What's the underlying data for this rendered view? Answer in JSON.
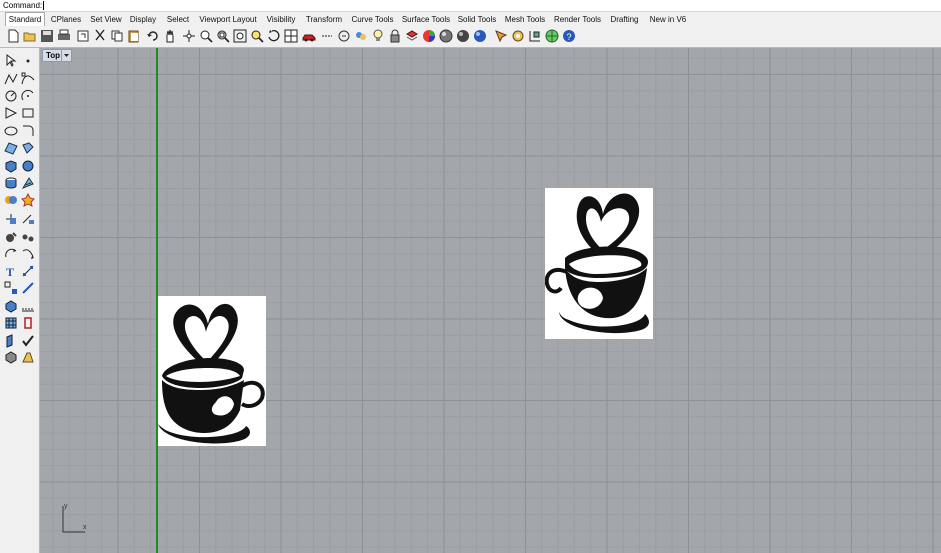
{
  "command": {
    "label": "Command:"
  },
  "tabs": [
    "Standard",
    "CPlanes",
    "Set View",
    "Display",
    "Select",
    "Viewport Layout",
    "Visibility",
    "Transform",
    "Curve Tools",
    "Surface Tools",
    "Solid Tools",
    "Mesh Tools",
    "Render Tools",
    "Drafting",
    "New in V6"
  ],
  "active_tab": "Standard",
  "viewport": {
    "title": "Top"
  },
  "axis": {
    "x": "x",
    "y": "y"
  },
  "colors": {
    "grid_bg": "#a3a7ac",
    "y_axis": "#228b22",
    "image_bg": "#ffffff"
  },
  "toolbar_icons": [
    "new-icon",
    "open-icon",
    "save-icon",
    "print-icon",
    "import-icon",
    "cut-icon",
    "copy-icon",
    "paste-icon",
    "undo-icon",
    "pan-icon",
    "rotate-icon",
    "zoom-icon",
    "zoom-window-icon",
    "zoom-extents-icon",
    "zoom-selected-icon",
    "rotate-view-icon",
    "viewport-layout-icon",
    "car-icon",
    "select-icon",
    "circle-icon",
    "group-icon",
    "light-icon",
    "lock-icon",
    "layer-icon",
    "color-icon",
    "render-icon",
    "sphere-icon",
    "material-icon",
    "tools-icon",
    "settings-icon",
    "grid-snap-icon",
    "globe-icon",
    "help-icon"
  ],
  "left_toolbar_icons": [
    "select-arrow-icon",
    "point-icon",
    "polyline-icon",
    "curve-icon",
    "circle-icon",
    "arc-icon",
    "polygon-icon",
    "rectangle-icon",
    "ellipse-icon",
    "fillet-icon",
    "surface-icon",
    "extrude-icon",
    "box-icon",
    "sphere-icon",
    "cylinder-icon",
    "mesh-icon",
    "boolean-icon",
    "explode-icon",
    "move-icon",
    "copy-icon",
    "text-icon",
    "scale-icon",
    "array-icon",
    "trim-icon",
    "split-icon",
    "join-icon",
    "dimension-icon",
    "check-icon",
    "layer-icon",
    "properties-icon"
  ]
}
